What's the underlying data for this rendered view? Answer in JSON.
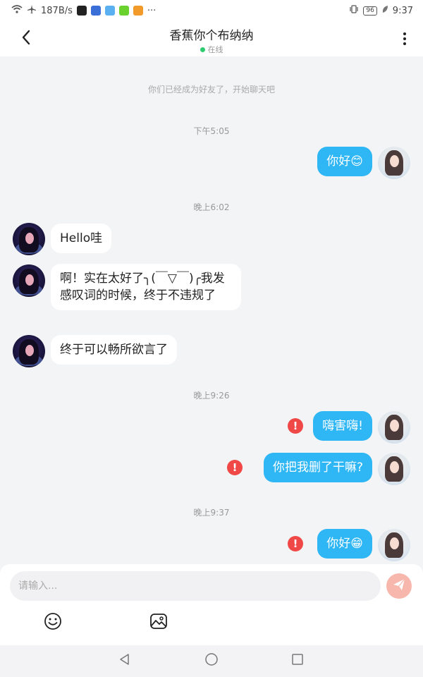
{
  "status_bar": {
    "speed": "187B/s",
    "more": "···",
    "battery": "96",
    "time": "9:37"
  },
  "header": {
    "title": "香蕉你个布纳纳",
    "status": "在线"
  },
  "chat": {
    "system_notice": "你们已经成为好友了，开始聊天吧",
    "time_1": "下午5:05",
    "msg_1": "你好😊",
    "time_2": "晚上6:02",
    "msg_2": "Hello哇",
    "msg_3": "啊！实在太好了╮(￣▽￣)╭我发感叹词的时候，终于不违规了",
    "msg_4": "终于可以畅所欲言了",
    "time_3": "晚上9:26",
    "msg_5": "嗨害嗨!",
    "msg_6": "你把我删了干嘛?",
    "time_4": "晚上9:37",
    "msg_7": "你好😁",
    "error_mark": "!"
  },
  "input": {
    "placeholder": "请输入..."
  },
  "icons": {
    "back": "chevron-left-icon",
    "more": "more-vertical-icon",
    "send": "paper-plane-icon",
    "emoji": "emoji-icon",
    "image": "image-icon",
    "error": "error-icon"
  },
  "colors": {
    "outgoing_bubble": "#2eb6f5",
    "incoming_bubble": "#ffffff",
    "error": "#f04747",
    "online": "#2ecc71",
    "send_button": "#f8b7ac"
  }
}
